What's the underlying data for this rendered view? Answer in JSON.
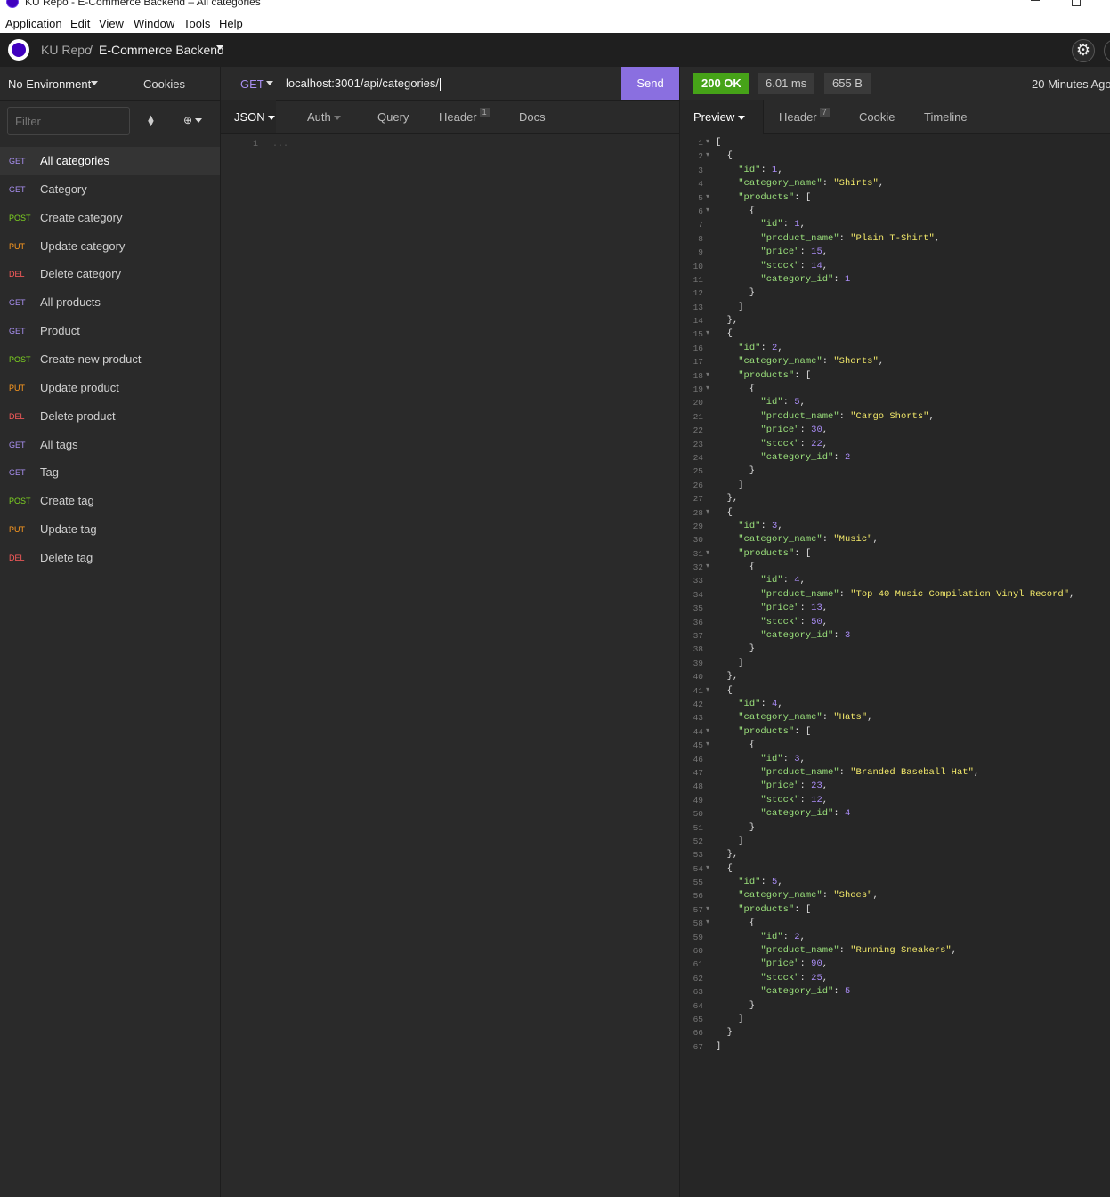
{
  "window": {
    "title": "KU Repo - E-Commerce Backend – All categories"
  },
  "menu": [
    "Application",
    "Edit",
    "View",
    "Window",
    "Tools",
    "Help"
  ],
  "breadcrumb": {
    "workspace": "KU Repo",
    "separator": "/",
    "collection": "E-Commerce Backend"
  },
  "sidebar": {
    "environment": "No Environment",
    "cookies": "Cookies",
    "filter_placeholder": "Filter",
    "requests": [
      {
        "method": "GET",
        "name": "All categories",
        "active": true
      },
      {
        "method": "GET",
        "name": "Category"
      },
      {
        "method": "POST",
        "name": "Create category"
      },
      {
        "method": "PUT",
        "name": "Update category"
      },
      {
        "method": "DEL",
        "name": "Delete category"
      },
      {
        "method": "GET",
        "name": "All products"
      },
      {
        "method": "GET",
        "name": "Product"
      },
      {
        "method": "POST",
        "name": "Create new product"
      },
      {
        "method": "PUT",
        "name": "Update product"
      },
      {
        "method": "DEL",
        "name": "Delete product"
      },
      {
        "method": "GET",
        "name": "All tags"
      },
      {
        "method": "GET",
        "name": "Tag"
      },
      {
        "method": "POST",
        "name": "Create tag"
      },
      {
        "method": "PUT",
        "name": "Update tag"
      },
      {
        "method": "DEL",
        "name": "Delete tag"
      }
    ]
  },
  "method_colors": {
    "GET": "#a88ff0",
    "POST": "#7ed321",
    "PUT": "#ff9a1f",
    "DEL": "#ff5c5c"
  },
  "request": {
    "method": "GET",
    "url": "localhost:3001/api/categories/",
    "send_label": "Send",
    "tabs": {
      "body": "JSON",
      "auth": "Auth",
      "query": "Query",
      "header": "Header",
      "header_count": "1",
      "docs": "Docs"
    },
    "body_line_number": "1",
    "body_placeholder": "..."
  },
  "response": {
    "status": "200 OK",
    "time": "6.01 ms",
    "size": "655 B",
    "age": "20 Minutes Ago",
    "tabs": {
      "preview": "Preview",
      "header": "Header",
      "header_count": "7",
      "cookie": "Cookie",
      "timeline": "Timeline"
    },
    "categories": [
      {
        "id": 1,
        "category_name": "Shirts",
        "products": [
          {
            "id": 1,
            "product_name": "Plain T-Shirt",
            "price": 15,
            "stock": 14,
            "category_id": 1
          }
        ]
      },
      {
        "id": 2,
        "category_name": "Shorts",
        "products": [
          {
            "id": 5,
            "product_name": "Cargo Shorts",
            "price": 30,
            "stock": 22,
            "category_id": 2
          }
        ]
      },
      {
        "id": 3,
        "category_name": "Music",
        "products": [
          {
            "id": 4,
            "product_name": "Top 40 Music Compilation Vinyl Record",
            "price": 13,
            "stock": 50,
            "category_id": 3
          }
        ]
      },
      {
        "id": 4,
        "category_name": "Hats",
        "products": [
          {
            "id": 3,
            "product_name": "Branded Baseball Hat",
            "price": 23,
            "stock": 12,
            "category_id": 4
          }
        ]
      },
      {
        "id": 5,
        "category_name": "Shoes",
        "products": [
          {
            "id": 2,
            "product_name": "Running Sneakers",
            "price": 90,
            "stock": 25,
            "category_id": 5
          }
        ]
      }
    ]
  }
}
